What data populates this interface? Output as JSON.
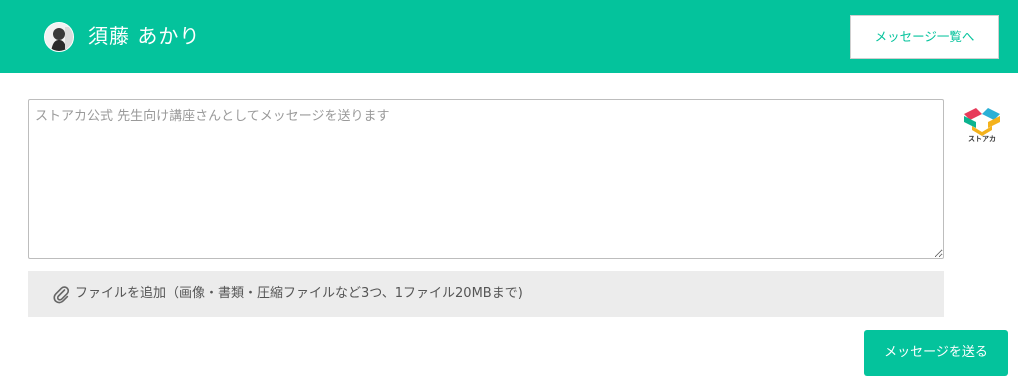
{
  "header": {
    "user_name": "須藤 あかり",
    "message_list_button": "メッセージ一覧へ"
  },
  "composer": {
    "placeholder": "ストアカ公式 先生向け講座さんとしてメッセージを送ります",
    "value": ""
  },
  "brand": {
    "logo_text": "ストアカ"
  },
  "attachment": {
    "label": "ファイルを追加（画像・書類・圧縮ファイルなど3つ、1ファイル20MBまで)"
  },
  "actions": {
    "send_button": "メッセージを送る"
  },
  "colors": {
    "accent": "#04c39c",
    "attach_bg": "#ececec"
  }
}
